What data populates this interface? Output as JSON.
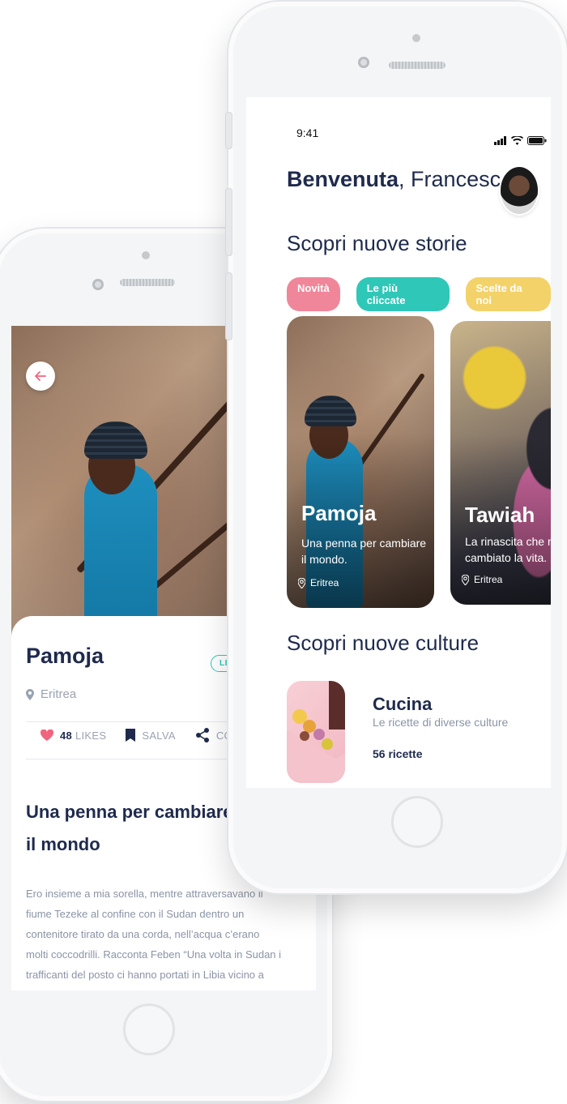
{
  "colors": {
    "navy": "#1f2a4d",
    "muted": "#9aa3b2",
    "pink": "#f0869a",
    "teal": "#2fc7b8",
    "yellow": "#f3d26a",
    "like_red": "#f0657e"
  },
  "detail": {
    "back_icon": "arrow-left-icon",
    "title": "Pamoja",
    "badge": "LEG",
    "location": "Eritrea",
    "likes_count": "48",
    "likes_label": "LIKES",
    "save_label": "SALVA",
    "share_label": "CO",
    "article_title": "Una penna per cambiare il mondo",
    "article_body": "Ero insieme a mia sorella, mentre attraversavano il fiume Tezeke al confine con il Sudan dentro un contenitore tirato da una corda, nell’acqua c’erano molti coccodrilli. Racconta Feben “Una volta in Sudan i trafficanti del posto ci hanno portati in Libia vicino a  Bengasi e ci hanno"
  },
  "home": {
    "status_time": "9:41",
    "greeting_bold": "Benvenuta",
    "greeting_name": ", Francesca",
    "section_stories_bold": "Scopri",
    "section_stories_rest": " nuove storie",
    "tags": [
      "Novità",
      "Le più cliccate",
      "Scelte da noi"
    ],
    "stories": [
      {
        "name": "Pamoja",
        "desc": "Una penna per cambiare il mondo.",
        "location": "Eritrea"
      },
      {
        "name": "Tawiah",
        "desc": "La rinascita che mi ha cambiato la vita.",
        "location": "Eritrea"
      }
    ],
    "section_cultures_bold": "Scopri",
    "section_cultures_rest": " nuove culture",
    "culture": {
      "name": "Cucina",
      "subtitle": "Le ricette di diverse culture",
      "count": "56 ricette"
    }
  }
}
